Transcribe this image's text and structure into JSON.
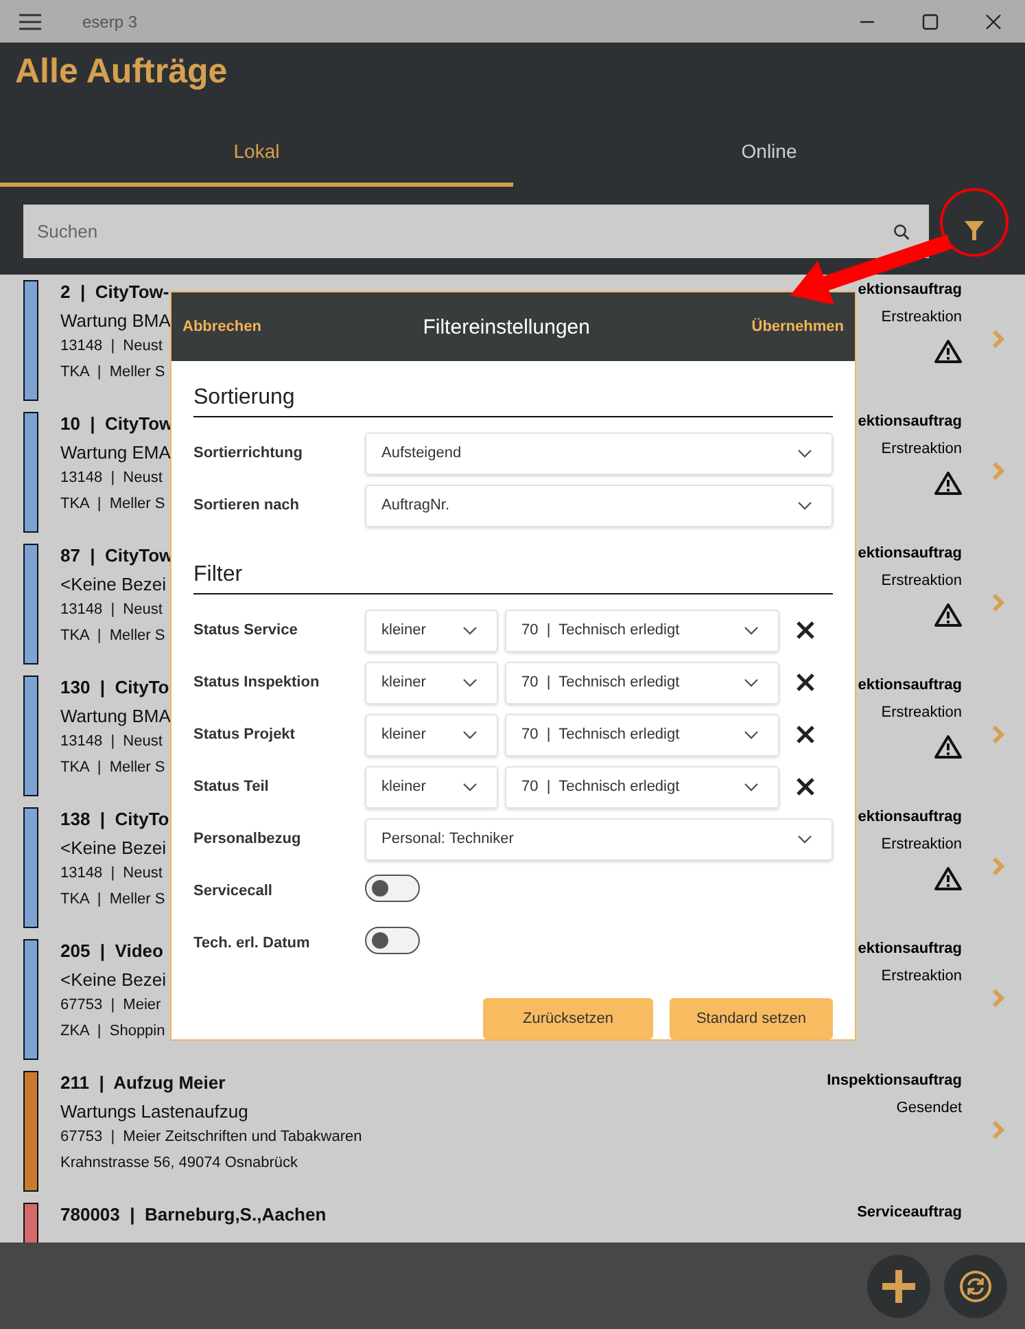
{
  "window": {
    "title": "eserp 3"
  },
  "page_title": "Alle Aufträge",
  "tabs": [
    {
      "label": "Lokal",
      "selected": true
    },
    {
      "label": "Online",
      "selected": false
    }
  ],
  "search": {
    "placeholder": "Suchen"
  },
  "orders": [
    {
      "title": "2  |  CityTow-",
      "description": "Wartung BMA",
      "line_3": "13148  |  Neust",
      "line_4": "TKA  |  Meller S",
      "kind": "ektionsauftrag",
      "status": "Erstreaktion",
      "color": "#7ba3d4",
      "warning": true
    },
    {
      "title": "10  |  CityTow",
      "description": "Wartung EMA",
      "line_3": "13148  |  Neust",
      "line_4": "TKA  |  Meller S",
      "kind": "ektionsauftrag",
      "status": "Erstreaktion",
      "color": "#7ba3d4",
      "warning": true
    },
    {
      "title": "87  |  CityTow",
      "description": "<Keine Bezei",
      "line_3": "13148  |  Neust",
      "line_4": "TKA  |  Meller S",
      "kind": "ektionsauftrag",
      "status": "Erstreaktion",
      "color": "#7ba3d4",
      "warning": true
    },
    {
      "title": "130  |  CityTo",
      "description": "Wartung BMA",
      "line_3": "13148  |  Neust",
      "line_4": "TKA  |  Meller S",
      "kind": "ektionsauftrag",
      "status": "Erstreaktion",
      "color": "#7ba3d4",
      "warning": true
    },
    {
      "title": "138  |  CityTo",
      "description": "<Keine Bezei",
      "line_3": "13148  |  Neust",
      "line_4": "TKA  |  Meller S",
      "kind": "ektionsauftrag",
      "status": "Erstreaktion",
      "color": "#7ba3d4",
      "warning": true
    },
    {
      "title": "205  |  Video",
      "description": "<Keine Bezei",
      "line_3": "67753  |  Meier",
      "line_4": "ZKA  |  Shoppin",
      "kind": "ektionsauftrag",
      "status": "Erstreaktion",
      "color": "#7ba3d4",
      "warning": false
    },
    {
      "title": "211  |  Aufzug Meier",
      "description": "Wartungs Lastenaufzug",
      "line_3": "67753  |  Meier Zeitschriften und Tabakwaren",
      "line_4": "Krahnstrasse 56, 49074 Osnabrück",
      "kind": "Inspektionsauftrag",
      "status": "Gesendet",
      "color": "#c87a30",
      "warning": false
    },
    {
      "title": "780003  |  Barneburg,S.,Aachen",
      "kind": "Serviceauftrag",
      "color": "#d46a6a",
      "warning": false
    }
  ],
  "filter_dialog": {
    "cancel": "Abbrechen",
    "title": "Filtereinstellungen",
    "apply": "Übernehmen",
    "sections": [
      {
        "heading": "Sortierung",
        "rows": [
          {
            "kind": "select",
            "label": "Sortierrichtung",
            "value": "Aufsteigend"
          },
          {
            "kind": "select",
            "label": "Sortieren nach",
            "value": "AuftragNr."
          }
        ]
      },
      {
        "heading": "Filter",
        "rows": [
          {
            "kind": "status",
            "label": "Status Service",
            "operator": "kleiner",
            "value": "70  |  Technisch erledigt"
          },
          {
            "kind": "status",
            "label": "Status Inspektion",
            "operator": "kleiner",
            "value": "70  |  Technisch erledigt"
          },
          {
            "kind": "status",
            "label": "Status Projekt",
            "operator": "kleiner",
            "value": "70  |  Technisch erledigt"
          },
          {
            "kind": "status",
            "label": "Status Teil",
            "operator": "kleiner",
            "value": "70  |  Technisch erledigt"
          },
          {
            "kind": "select",
            "label": "Personalbezug",
            "value": "Personal: Techniker"
          },
          {
            "kind": "toggle",
            "label": "Servicecall",
            "on": false
          },
          {
            "kind": "toggle",
            "label": "Tech. erl. Datum",
            "on": false
          }
        ]
      }
    ],
    "buttons": [
      "Zurücksetzen",
      "Standard setzen"
    ]
  }
}
